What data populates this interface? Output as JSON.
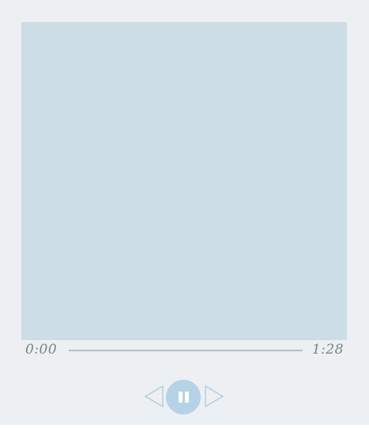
{
  "player": {
    "time_elapsed": "0:00",
    "time_total": "1:28",
    "progress": 0.0,
    "icons": {
      "previous": "triangle-left-icon",
      "pause": "pause-icon",
      "next": "triangle-right-icon"
    },
    "colors": {
      "background": "#ecf0f3",
      "artwork": "#cddde5",
      "accent": "#b5d2e6",
      "track": "#b7bdc1",
      "text": "#7c8286"
    }
  }
}
